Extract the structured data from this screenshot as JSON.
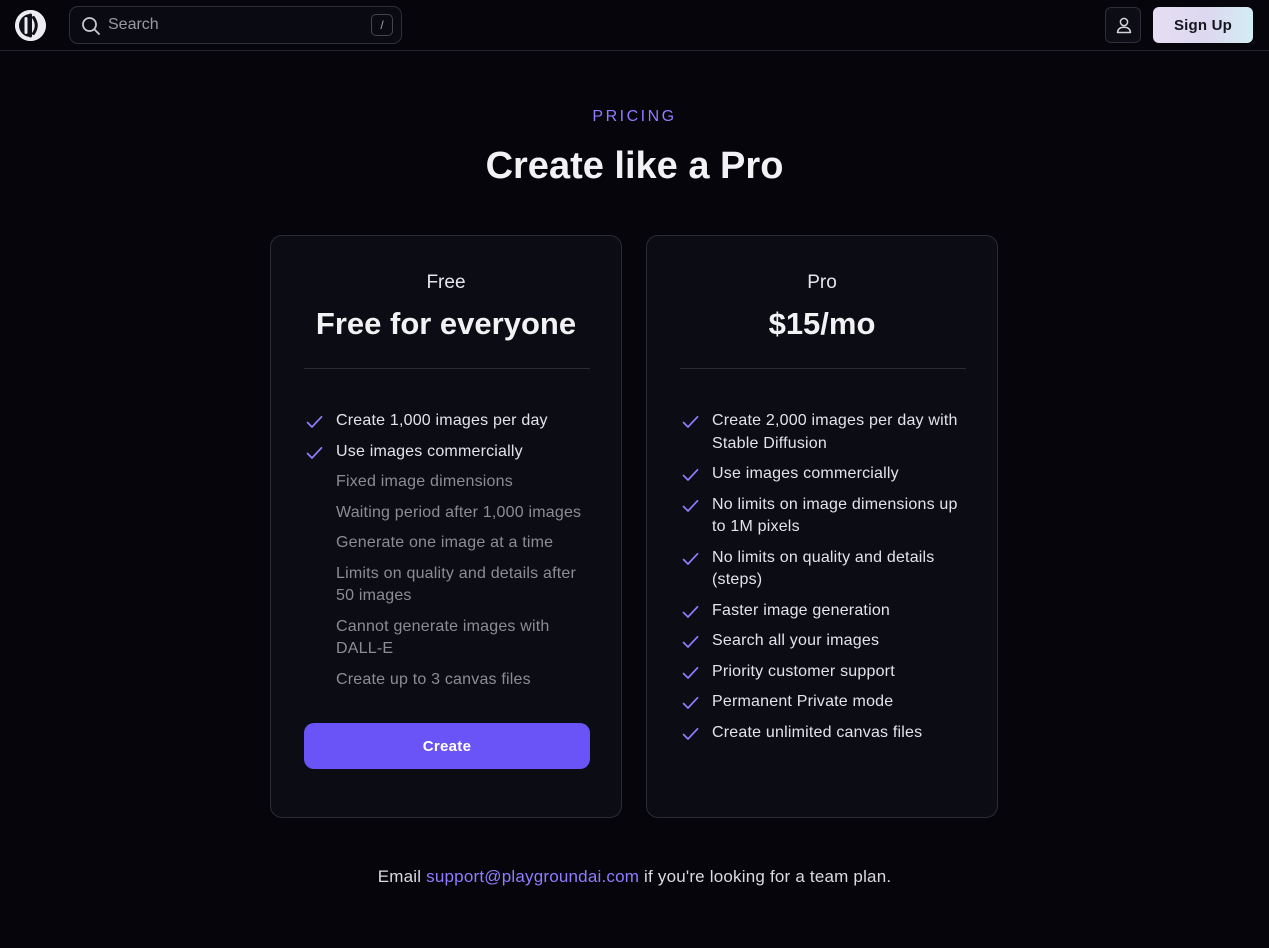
{
  "header": {
    "search": {
      "placeholder": "Search",
      "shortcut_key": "/"
    },
    "user_icon": "user-icon",
    "signup_label": "Sign Up"
  },
  "hero": {
    "eyebrow": "PRICING",
    "title": "Create like a Pro"
  },
  "plans": [
    {
      "name": "Free",
      "price": "Free for everyone",
      "cta_label": "Create",
      "features": [
        {
          "text": "Create 1,000 images per day",
          "included": true
        },
        {
          "text": "Use images commercially",
          "included": true
        },
        {
          "text": "Fixed image dimensions",
          "included": false
        },
        {
          "text": "Waiting period after 1,000 images",
          "included": false
        },
        {
          "text": "Generate one image at a time",
          "included": false
        },
        {
          "text": "Limits on quality and details after 50 images",
          "included": false
        },
        {
          "text": "Cannot generate images with DALL-E",
          "included": false
        },
        {
          "text": "Create up to 3 canvas files",
          "included": false
        }
      ]
    },
    {
      "name": "Pro",
      "price": "$15/mo",
      "features": [
        {
          "text": "Create 2,000 images per day with Stable Diffusion",
          "included": true
        },
        {
          "text": "Use images commercially",
          "included": true
        },
        {
          "text": "No limits on image dimensions up to 1M pixels",
          "included": true
        },
        {
          "text": "No limits on quality and details (steps)",
          "included": true
        },
        {
          "text": "Faster image generation",
          "included": true
        },
        {
          "text": "Search all your images",
          "included": true
        },
        {
          "text": "Priority customer support",
          "included": true
        },
        {
          "text": "Permanent Private mode",
          "included": true
        },
        {
          "text": "Create unlimited canvas files",
          "included": true
        }
      ]
    }
  ],
  "footer": {
    "prefix": "Email",
    "email": "support@playgroundai.com",
    "suffix": "if you're looking for a team plan."
  },
  "colors": {
    "accent": "#6b54f7",
    "accent_text": "#8f7cff",
    "background": "#05050b",
    "card": "#0c0c14"
  }
}
